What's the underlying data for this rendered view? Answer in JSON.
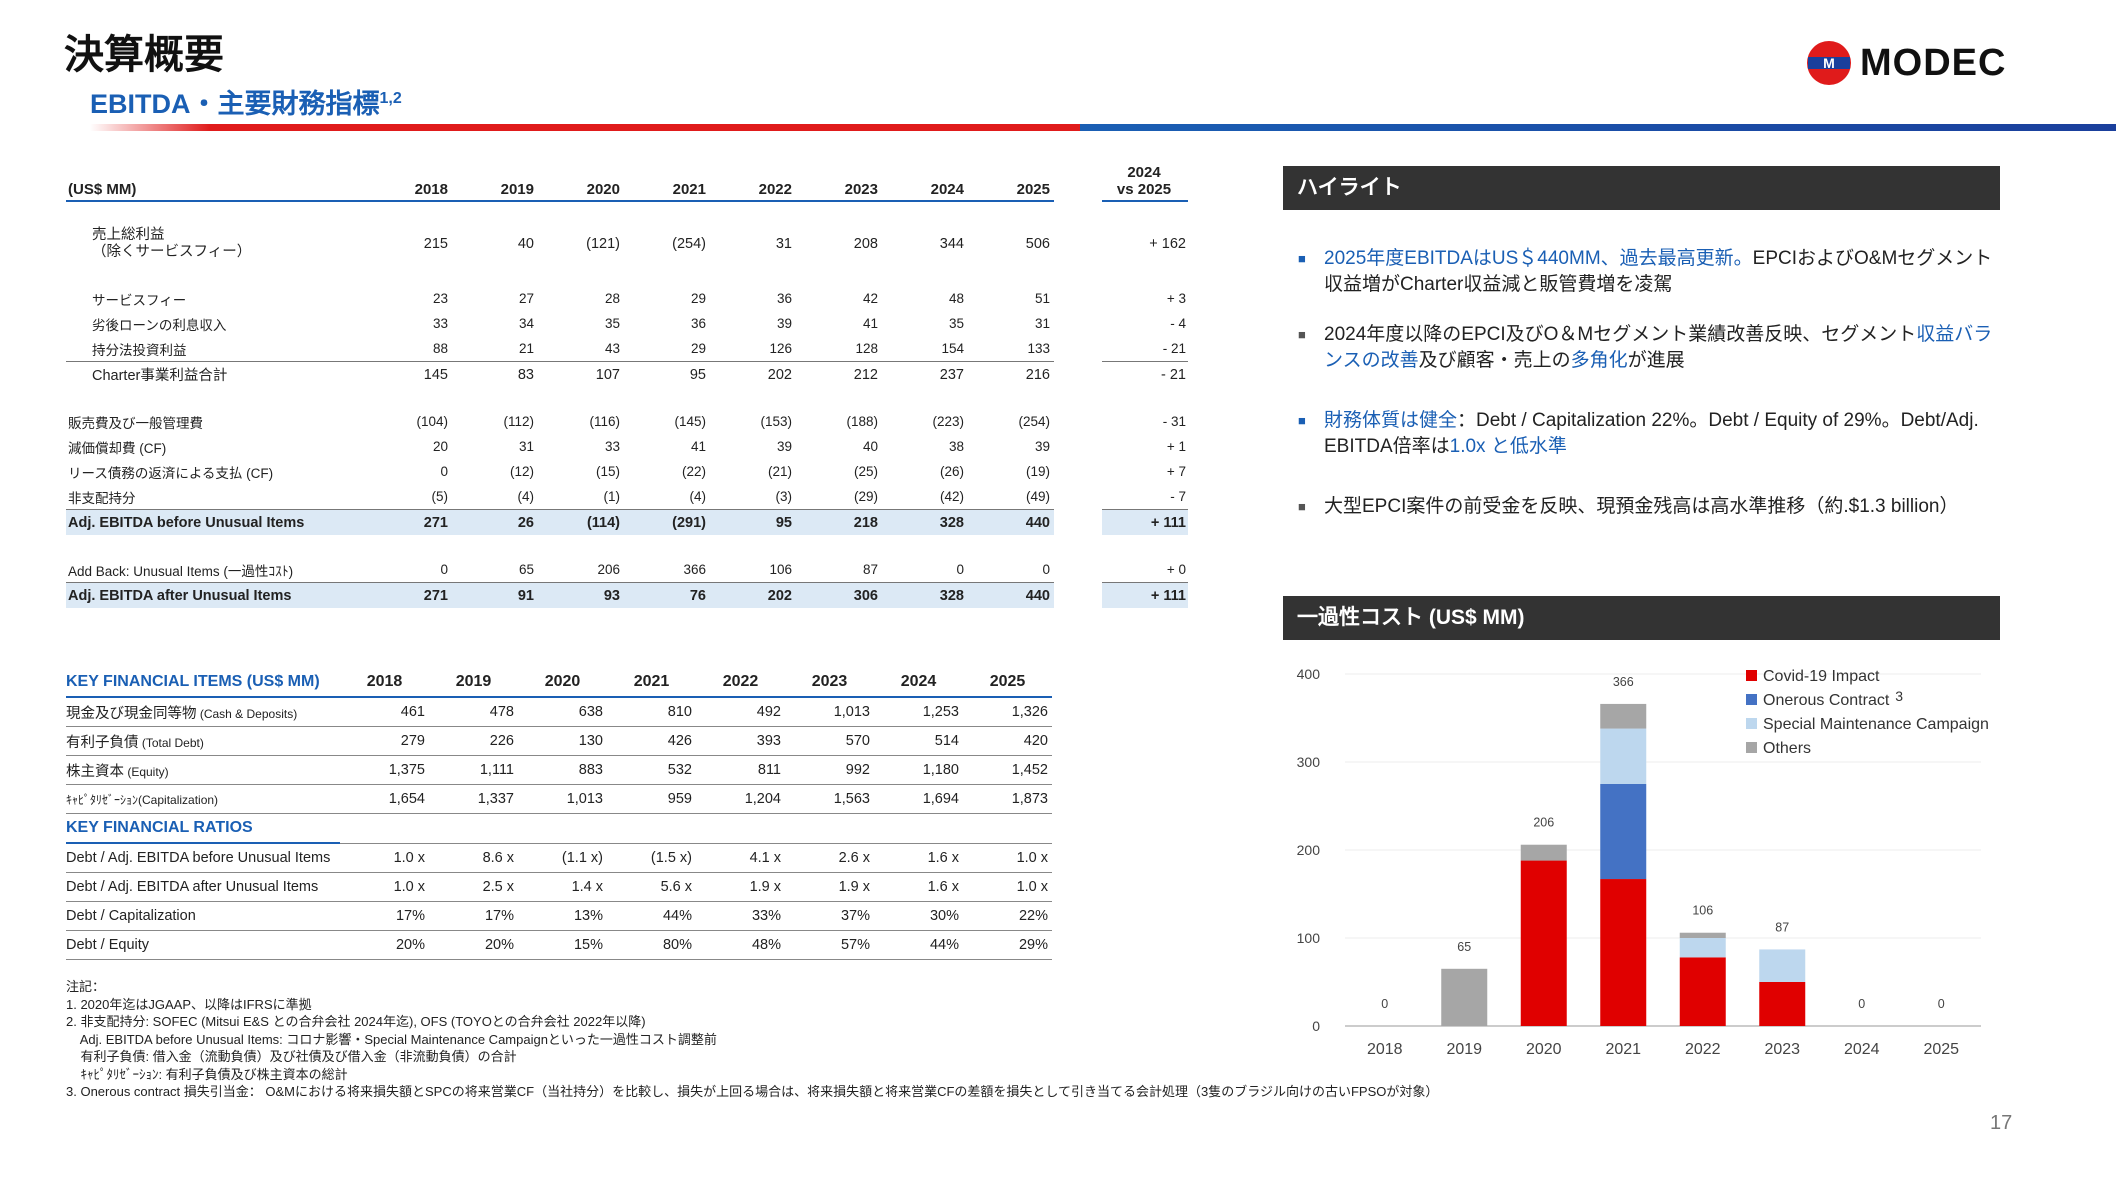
{
  "header": {
    "title": "決算概要",
    "subtitle": "EBITDA・主要財務指標",
    "subtitle_sup": "1,2",
    "logo_text": "MODEC"
  },
  "fin_table": {
    "unit_label": "(US$ MM)",
    "years": [
      "2018",
      "2019",
      "2020",
      "2021",
      "2022",
      "2023",
      "2024",
      "2025"
    ],
    "delta_header_1": "2024",
    "delta_header_2": "vs 2025",
    "rows": [
      {
        "label": "売上総利益",
        "label2": "（除くサービスフィー）",
        "values": [
          "215",
          "40",
          "(121)",
          "(254)",
          "31",
          "208",
          "344",
          "506"
        ],
        "delta": "+ 162"
      },
      {
        "label": "サービスフィー",
        "values": [
          "23",
          "27",
          "28",
          "29",
          "36",
          "42",
          "48",
          "51"
        ],
        "delta": "+ 3"
      },
      {
        "label": "劣後ローンの利息収入",
        "values": [
          "33",
          "34",
          "35",
          "36",
          "39",
          "41",
          "35",
          "31"
        ],
        "delta": "- 4"
      },
      {
        "label": "持分法投資利益",
        "values": [
          "88",
          "21",
          "43",
          "29",
          "126",
          "128",
          "154",
          "133"
        ],
        "delta": "- 21"
      },
      {
        "label": "Charter事業利益合計",
        "values": [
          "145",
          "83",
          "107",
          "95",
          "202",
          "212",
          "237",
          "216"
        ],
        "delta": "- 21"
      },
      {
        "label": "販売費及び一般管理費",
        "values": [
          "(104)",
          "(112)",
          "(116)",
          "(145)",
          "(153)",
          "(188)",
          "(223)",
          "(254)"
        ],
        "delta": "- 31"
      },
      {
        "label": "減価償却費 (CF)",
        "values": [
          "20",
          "31",
          "33",
          "41",
          "39",
          "40",
          "38",
          "39"
        ],
        "delta": "+ 1"
      },
      {
        "label": "リース債務の返済による支払 (CF)",
        "values": [
          "0",
          "(12)",
          "(15)",
          "(22)",
          "(21)",
          "(25)",
          "(26)",
          "(19)"
        ],
        "delta": "+ 7"
      },
      {
        "label": "非支配持分",
        "values": [
          "(5)",
          "(4)",
          "(1)",
          "(4)",
          "(3)",
          "(29)",
          "(42)",
          "(49)"
        ],
        "delta": "- 7"
      },
      {
        "label": "Adj. EBITDA before Unusual Items",
        "values": [
          "271",
          "26",
          "(114)",
          "(291)",
          "95",
          "218",
          "328",
          "440"
        ],
        "delta": "+ 111"
      },
      {
        "label": "Add Back: Unusual Items (一過性ｺｽﾄ)",
        "values": [
          "0",
          "65",
          "206",
          "366",
          "106",
          "87",
          "0",
          "0"
        ],
        "delta": "+ 0"
      },
      {
        "label": "Adj. EBITDA after Unusual Items",
        "values": [
          "271",
          "91",
          "93",
          "76",
          "202",
          "306",
          "328",
          "440"
        ],
        "delta": "+ 111"
      }
    ]
  },
  "kfi": {
    "title": "KEY FINANCIAL ITEMS (US$ MM)",
    "years": [
      "2018",
      "2019",
      "2020",
      "2021",
      "2022",
      "2023",
      "2024",
      "2025"
    ],
    "rows": [
      {
        "label": "現金及び現金同等物",
        "label_small": " (Cash & Deposits)",
        "values": [
          "461",
          "478",
          "638",
          "810",
          "492",
          "1,013",
          "1,253",
          "1,326"
        ]
      },
      {
        "label": "有利子負債",
        "label_small": " (Total Debt)",
        "values": [
          "279",
          "226",
          "130",
          "426",
          "393",
          "570",
          "514",
          "420"
        ]
      },
      {
        "label": "株主資本",
        "label_small": " (Equity)",
        "values": [
          "1,375",
          "1,111",
          "883",
          "532",
          "811",
          "992",
          "1,180",
          "1,452"
        ]
      },
      {
        "label": "ｷｬﾋﾟﾀﾘｾﾞｰｼｮﾝ",
        "label_small": "(Capitalization)",
        "values": [
          "1,654",
          "1,337",
          "1,013",
          "959",
          "1,204",
          "1,563",
          "1,694",
          "1,873"
        ]
      }
    ],
    "ratios_title": "KEY FINANCIAL RATIOS",
    "ratio_rows": [
      {
        "label": "Debt / Adj. EBITDA before Unusual Items",
        "values": [
          "1.0 x",
          "8.6 x",
          "(1.1 x)",
          "(1.5 x)",
          "4.1 x",
          "2.6 x",
          "1.6 x",
          "1.0 x"
        ]
      },
      {
        "label": "Debt / Adj. EBITDA after Unusual Items",
        "values": [
          "1.0 x",
          "2.5 x",
          "1.4 x",
          "5.6 x",
          "1.9 x",
          "1.9 x",
          "1.6 x",
          "1.0 x"
        ]
      },
      {
        "label": "Debt / Capitalization",
        "values": [
          "17%",
          "17%",
          "13%",
          "44%",
          "33%",
          "37%",
          "30%",
          "22%"
        ]
      },
      {
        "label": "Debt / Equity",
        "values": [
          "20%",
          "20%",
          "15%",
          "80%",
          "48%",
          "57%",
          "44%",
          "29%"
        ]
      }
    ]
  },
  "notes": {
    "heading": "注記：",
    "lines": [
      "1. 2020年迄はJGAAP、以降はIFRSに準拠",
      "2. 非支配持分: SOFEC (Mitsui E&S との合弁会社 2024年迄), OFS (TOYOとの合弁会社 2022年以降)",
      "    Adj. EBITDA before Unusual Items: コロナ影響・Special Maintenance Campaignといった一過性コスト調整前",
      "    有利子負債: 借入金（流動負債）及び社債及び借入金（非流動負債）の合計",
      "    ｷｬﾋﾟﾀﾘｾﾞｰｼｮﾝ: 有利子負債及び株主資本の総計",
      "3. Onerous contract 損失引当金： O&Mにおける将来損失額とSPCの将来営業CF（当社持分）を比較し、損失が上回る場合は、将来損失額と将来営業CFの差額を損失として引き当てる会計処理（3隻のブラジル向けの古いFPSOが対象）"
    ]
  },
  "highlights": {
    "title": "ハイライト",
    "b1_blue": "2025年度EBITDAはUS＄440MM、過去最高更新。",
    "b1_rest": "EPCIおよびO&Mセグメント収益増がCharter収益減と販管費増を凌駕",
    "b2_a": "2024年度以降のEPCI及びO＆Mセグメント業績改善反映、セグメント",
    "b2_blue1": "収益バランスの改善",
    "b2_b": "及び顧客・売上の",
    "b2_blue2": "多角化",
    "b2_c": "が進展",
    "b3_blue1": "財務体質は健全",
    "b3_a": "：Debt / Capitalization 22%。Debt / Equity of 29%。Debt/Adj. EBITDA倍率は",
    "b3_blue2": "1.0x と低水準",
    "b4": "大型EPCI案件の前受金を反映、現預金残高は高水準推移（約.$1.3 billion）"
  },
  "chart_title": "一過性コスト (US$ MM)",
  "chart_data": {
    "type": "bar",
    "stacked": true,
    "categories": [
      "2018",
      "2019",
      "2020",
      "2021",
      "2022",
      "2023",
      "2024",
      "2025"
    ],
    "ylim": [
      0,
      400
    ],
    "yticks": [
      "0",
      "100",
      "200",
      "300",
      "400"
    ],
    "totals": [
      "0",
      "65",
      "206",
      "366",
      "106",
      "87",
      "0",
      "0"
    ],
    "series": [
      {
        "name": "Covid-19 Impact",
        "color": "#e00000",
        "values": [
          0,
          0,
          188,
          167,
          78,
          50,
          0,
          0
        ]
      },
      {
        "name": "Onerous Contract",
        "name_sup": "3",
        "color": "#4472c4",
        "values": [
          0,
          0,
          0,
          108,
          0,
          0,
          0,
          0
        ]
      },
      {
        "name": "Special Maintenance Campaign",
        "color": "#bdd7ee",
        "values": [
          0,
          0,
          0,
          63,
          22,
          37,
          0,
          0
        ]
      },
      {
        "name": "Others",
        "color": "#a6a6a6",
        "values": [
          0,
          65,
          18,
          28,
          6,
          0,
          0,
          0
        ]
      }
    ],
    "legend_position": "top-right"
  },
  "page_number": "17"
}
